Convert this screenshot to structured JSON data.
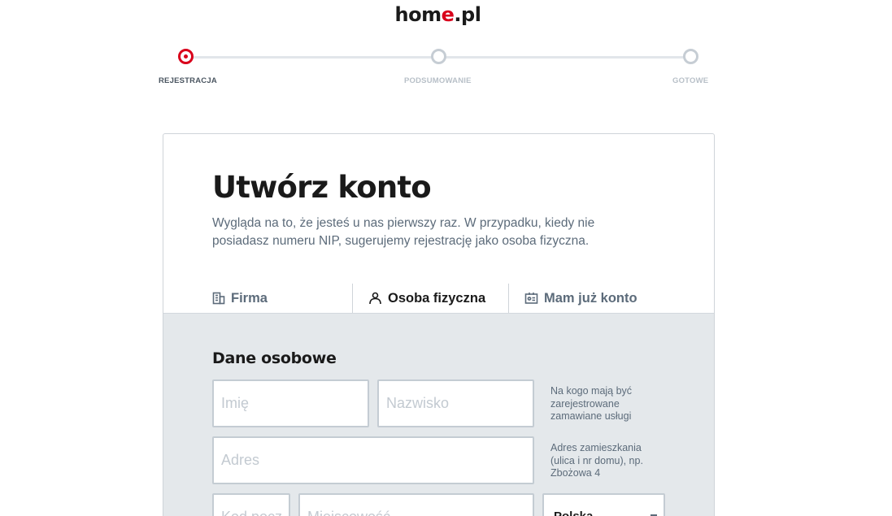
{
  "logo": {
    "part1": "hom",
    "accent": "e",
    "part2": ".pl"
  },
  "stepper": {
    "steps": [
      {
        "label": "REJESTRACJA",
        "active": true
      },
      {
        "label": "PODSUMOWANIE",
        "active": false
      },
      {
        "label": "GOTOWE",
        "active": false
      }
    ]
  },
  "card": {
    "title": "Utwórz konto",
    "description": "Wygląda na to, że jesteś u nas pierwszy raz. W przypadku, kiedy nie posiadasz numeru NIP, sugerujemy rejestrację jako osoba fizyczna."
  },
  "tabs": [
    {
      "label": "Firma",
      "icon": "building-icon",
      "active": false
    },
    {
      "label": "Osoba fizyczna",
      "icon": "person-icon",
      "active": true
    },
    {
      "label": "Mam już konto",
      "icon": "id-card-icon",
      "active": false
    }
  ],
  "form": {
    "section_title": "Dane osobowe",
    "first_name": {
      "placeholder": "Imię",
      "value": ""
    },
    "last_name": {
      "placeholder": "Nazwisko",
      "value": ""
    },
    "name_hint": "Na kogo mają być zarejestrowane zamawiane usługi",
    "address": {
      "placeholder": "Adres",
      "value": ""
    },
    "address_hint": "Adres zamieszkania (ulica i nr domu), np. Zbożowa 4",
    "postal_code": {
      "placeholder": "Kod pocz.",
      "value": ""
    },
    "city": {
      "placeholder": "Miejscowość",
      "value": ""
    },
    "country": {
      "selected": "Polska"
    }
  },
  "colors": {
    "accent": "#d9001b",
    "muted_text": "#5c6b7a",
    "panel_bg": "#e4e8eb"
  }
}
